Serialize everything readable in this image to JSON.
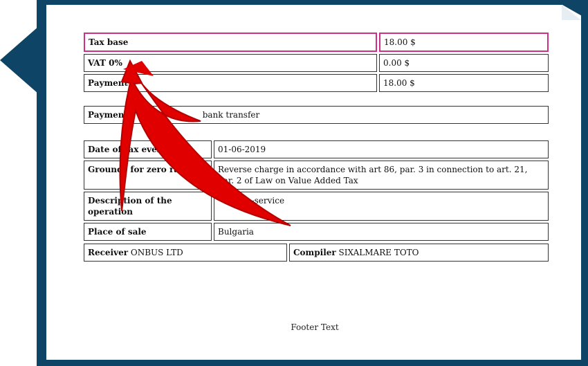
{
  "totals": {
    "tax_base_label": "Tax base",
    "tax_base_value": "18.00 $",
    "vat_label": "VAT 0%",
    "vat_value": "0.00 $",
    "payment_label": "Payment",
    "payment_value": "18.00 $"
  },
  "payment_method": {
    "label": "Payment",
    "value": "bank transfer"
  },
  "details": {
    "date_label": "Date of tax event",
    "date_value": "01-06-2019",
    "grounds_label": "Grounds for zero rate",
    "grounds_value": "Reverse charge in accordance with art 86, par. 3 in connection to art. 21, par. 2 of Law on Value Added Tax",
    "description_label": "Description of the operation",
    "description_value": "of e-service",
    "place_label": "Place of sale",
    "place_value": "Bulgaria"
  },
  "parties": {
    "receiver_label": "Receiver",
    "receiver_value": "ONBUS LTD",
    "compiler_label": "Compiler",
    "compiler_value": "SIXALMARE TOTO"
  },
  "footer": {
    "text": "Footer Text"
  },
  "colors": {
    "frame": "#0e4466",
    "highlight": "#cc2f83",
    "arrow": "#e00000"
  }
}
